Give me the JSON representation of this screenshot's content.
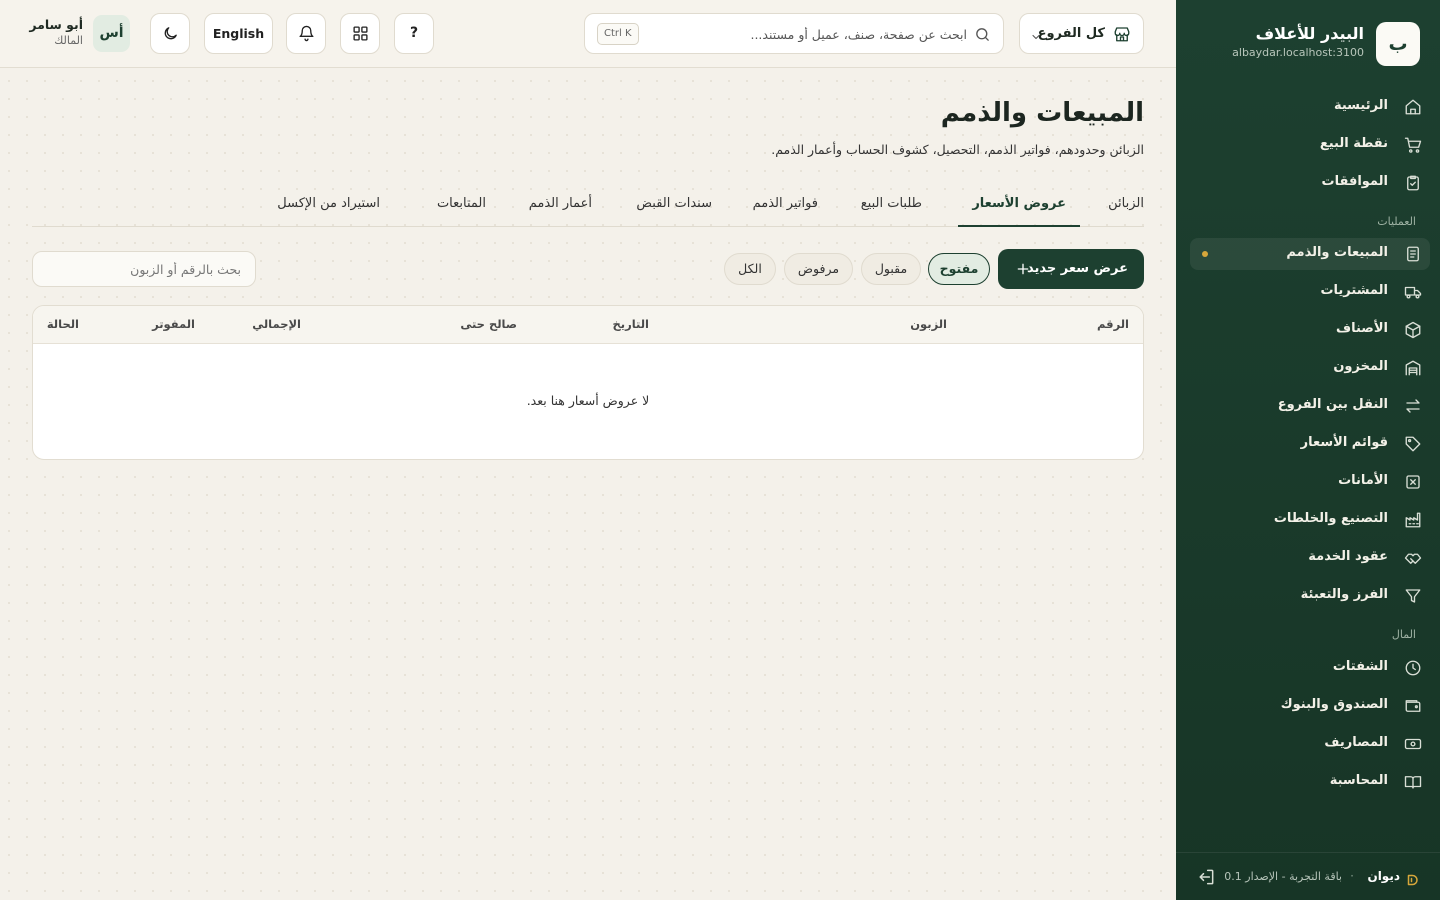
{
  "sidebar": {
    "brand": {
      "logo_letter": "ب",
      "name": "البيدر للأعلاف",
      "host": "albaydar.localhost:3100"
    },
    "items": [
      {
        "label": "الرئيسية",
        "icon": "home-icon"
      },
      {
        "label": "نقطة البيع",
        "icon": "cart-icon"
      },
      {
        "label": "الموافقات",
        "icon": "clipboard-check-icon"
      },
      {
        "label": "المبيعات والذمم",
        "icon": "receipt-icon",
        "active": true
      },
      {
        "label": "المشتريات",
        "icon": "truck-icon"
      },
      {
        "label": "الأصناف",
        "icon": "box-icon"
      },
      {
        "label": "المخزون",
        "icon": "warehouse-icon"
      },
      {
        "label": "النقل بين الفروع",
        "icon": "arrows-swap-icon"
      },
      {
        "label": "قوائم الأسعار",
        "icon": "tag-icon"
      },
      {
        "label": "الأمانات",
        "icon": "package-x-icon"
      },
      {
        "label": "التصنيع والخلطات",
        "icon": "factory-icon"
      },
      {
        "label": "عقود الخدمة",
        "icon": "handshake-icon"
      },
      {
        "label": "الفرز والتعبئة",
        "icon": "filter-icon"
      },
      {
        "label": "الشفتات",
        "icon": "clock-icon"
      },
      {
        "label": "الصندوق والبنوك",
        "icon": "wallet-icon"
      },
      {
        "label": "المصاريف",
        "icon": "banknote-icon"
      },
      {
        "label": "المحاسبة",
        "icon": "book-icon"
      }
    ],
    "sections": {
      "operations": "العمليات",
      "finance": "المال"
    },
    "footer": {
      "brand": "ديوان",
      "separator": "·",
      "version": "باقة التجربة - الإصدار 0.1"
    }
  },
  "topbar": {
    "branch_label": "كل الفروع",
    "search_placeholder": "ابحث عن صفحة، صنف، عميل أو مستند...",
    "shortcut": "Ctrl K",
    "help_label": "?",
    "language_label": "English",
    "user": {
      "initials": "أس",
      "name": "أبو سامر",
      "role": "المالك"
    }
  },
  "page": {
    "title": "المبيعات والذمم",
    "subtitle": "الزبائن وحدودهم، فواتير الذمم، التحصيل، كشوف الحساب وأعمار الذمم."
  },
  "tabs": [
    "الزبائن",
    "عروض الأسعار",
    "طلبات البيع",
    "فواتير الذمم",
    "سندات القبض",
    "أعمار الذمم",
    "المتابعات",
    "استيراد من الإكسل"
  ],
  "active_tab": 1,
  "toolbar": {
    "new_button": "عرض سعر جديد",
    "filters": [
      "مفتوح",
      "مقبول",
      "مرفوض",
      "الكل"
    ],
    "active_filter": 0,
    "search_placeholder": "بحث بالرقم أو الزبون"
  },
  "table": {
    "columns": [
      "الرقم",
      "الزبون",
      "التاريخ",
      "صالح حتى",
      "الإجمالي",
      "المفوتر",
      "الحالة"
    ],
    "empty_message": "لا عروض أسعار هنا بعد."
  },
  "colors": {
    "sidebar": "#1d4030",
    "accent": "#1d4030",
    "active_dot": "#d7a73b",
    "background": "#f4f1ea"
  }
}
